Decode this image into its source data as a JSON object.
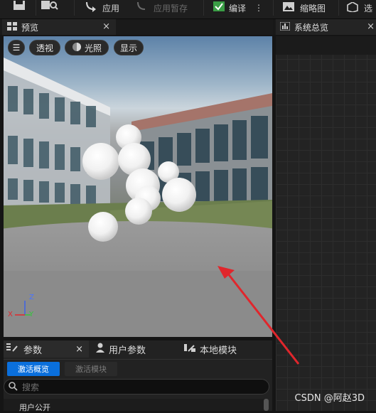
{
  "toolbar": {
    "apply_label": "应用",
    "apply_temp_label": "应用暂存",
    "compile_label": "编译",
    "thumbnail_label": "缩略图",
    "last_label": "选"
  },
  "preview_panel": {
    "title": "预览",
    "view_buttons": [
      "透视",
      "光照",
      "显示"
    ],
    "axis": {
      "z": "Z",
      "x": "X",
      "y": "Y"
    }
  },
  "system_panel": {
    "title": "系统总览"
  },
  "params_panel": {
    "tabs": [
      "参数",
      "用户参数",
      "本地模块"
    ],
    "sub_tabs": [
      "激活概览",
      "激活模块"
    ],
    "search_placeholder": "搜索",
    "first_row": "用户公开"
  },
  "watermark": "CSDN @阿赵3D",
  "colors": {
    "accent_blue": "#0a6fdc",
    "arrow_red": "#e0262c",
    "panel_bg": "#222222"
  }
}
